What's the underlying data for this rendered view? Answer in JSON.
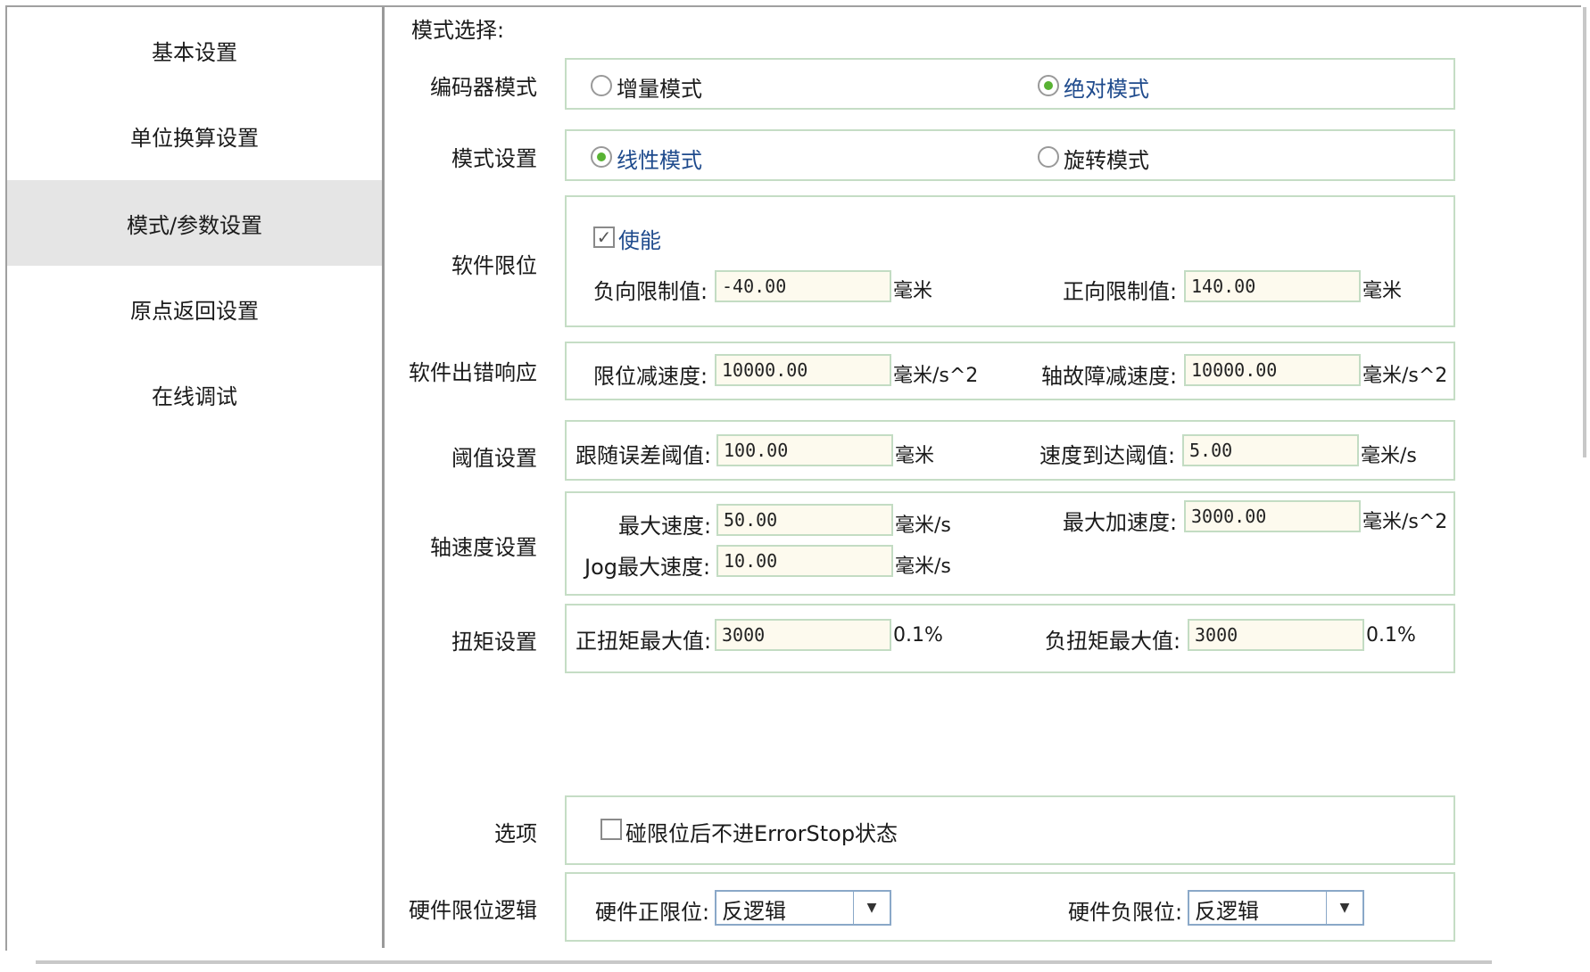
{
  "sidebar": {
    "items": [
      {
        "label": "基本设置"
      },
      {
        "label": "单位换算设置"
      },
      {
        "label": "模式/参数设置"
      },
      {
        "label": "原点返回设置"
      },
      {
        "label": "在线调试"
      }
    ],
    "active_index": 2
  },
  "main": {
    "heading": "模式选择:",
    "encoder_mode": {
      "label": "编码器模式",
      "options": [
        "增量模式",
        "绝对模式"
      ],
      "selected": "绝对模式"
    },
    "mode_setting": {
      "label": "模式设置",
      "options": [
        "线性模式",
        "旋转模式"
      ],
      "selected": "线性模式"
    },
    "soft_limit": {
      "label": "软件限位",
      "enable_label": "使能",
      "enabled": true,
      "neg_label": "负向限制值:",
      "neg_value": "-40.00",
      "neg_unit": "毫米",
      "pos_label": "正向限制值:",
      "pos_value": "140.00",
      "pos_unit": "毫米"
    },
    "error_response": {
      "label": "软件出错响应",
      "limit_decel_label": "限位减速度:",
      "limit_decel_value": "10000.00",
      "limit_decel_unit": "毫米/s^2",
      "fault_decel_label": "轴故障减速度:",
      "fault_decel_value": "10000.00",
      "fault_decel_unit": "毫米/s^2"
    },
    "threshold": {
      "label": "阈值设置",
      "follow_label": "跟随误差阈值:",
      "follow_value": "100.00",
      "follow_unit": "毫米",
      "speed_label": "速度到达阈值:",
      "speed_value": "5.00",
      "speed_unit": "毫米/s"
    },
    "axis_speed": {
      "label": "轴速度设置",
      "max_speed_label": "最大速度:",
      "max_speed_value": "50.00",
      "max_speed_unit": "毫米/s",
      "max_accel_label": "最大加速度:",
      "max_accel_value": "3000.00",
      "max_accel_unit": "毫米/s^2",
      "jog_label": "Jog最大速度:",
      "jog_value": "10.00",
      "jog_unit": "毫米/s"
    },
    "torque": {
      "label": "扭矩设置",
      "pos_label": "正扭矩最大值:",
      "pos_value": "3000",
      "pos_unit": "0.1%",
      "neg_label": "负扭矩最大值:",
      "neg_value": "3000",
      "neg_unit": "0.1%"
    },
    "options": {
      "label": "选项",
      "no_errorstop_label": "碰限位后不进ErrorStop状态",
      "no_errorstop_checked": false
    },
    "hw_limit": {
      "label": "硬件限位逻辑",
      "pos_label": "硬件正限位:",
      "pos_value": "反逻辑",
      "neg_label": "硬件负限位:",
      "neg_value": "反逻辑"
    }
  },
  "colors": {
    "radio_selected": "#58b233",
    "selected_text": "#1e4a8c",
    "input_bg": "#fdfaee",
    "group_border": "#c5ddc5",
    "active_nav_bg": "#e5e5e5"
  }
}
